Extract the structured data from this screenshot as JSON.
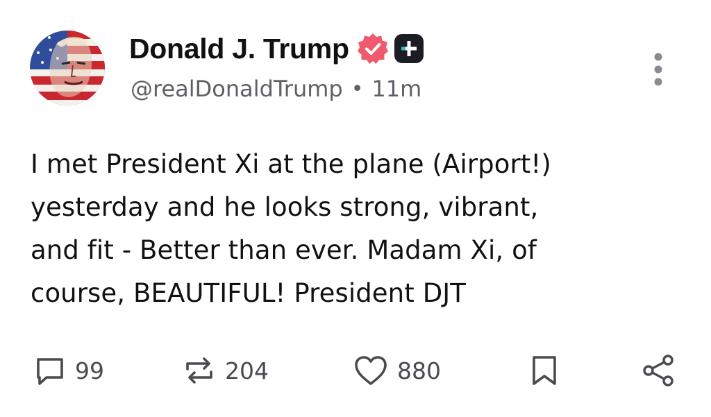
{
  "author": {
    "display_name": "Donald J. Trump",
    "handle": "@realDonaldTrump",
    "time_ago": "11m",
    "separator": "•",
    "verified_badge_color": "#f05a6e",
    "plus_badge_color": "#1c1c24"
  },
  "post": {
    "lines": [
      "I met President Xi at the plane (Airport!)",
      "yesterday and he looks strong, vibrant,",
      "and fit - Better than ever. Madam Xi, of",
      "course, BEAUTIFUL! President DJT"
    ]
  },
  "actions": {
    "replies": "99",
    "reposts": "204",
    "likes": "880",
    "icons": [
      "comment-icon",
      "repost-icon",
      "heart-icon",
      "bookmark-icon",
      "share-icon"
    ]
  },
  "colors": {
    "text": "#111111",
    "muted": "#5f5f68",
    "icon": "#4a4a52"
  }
}
